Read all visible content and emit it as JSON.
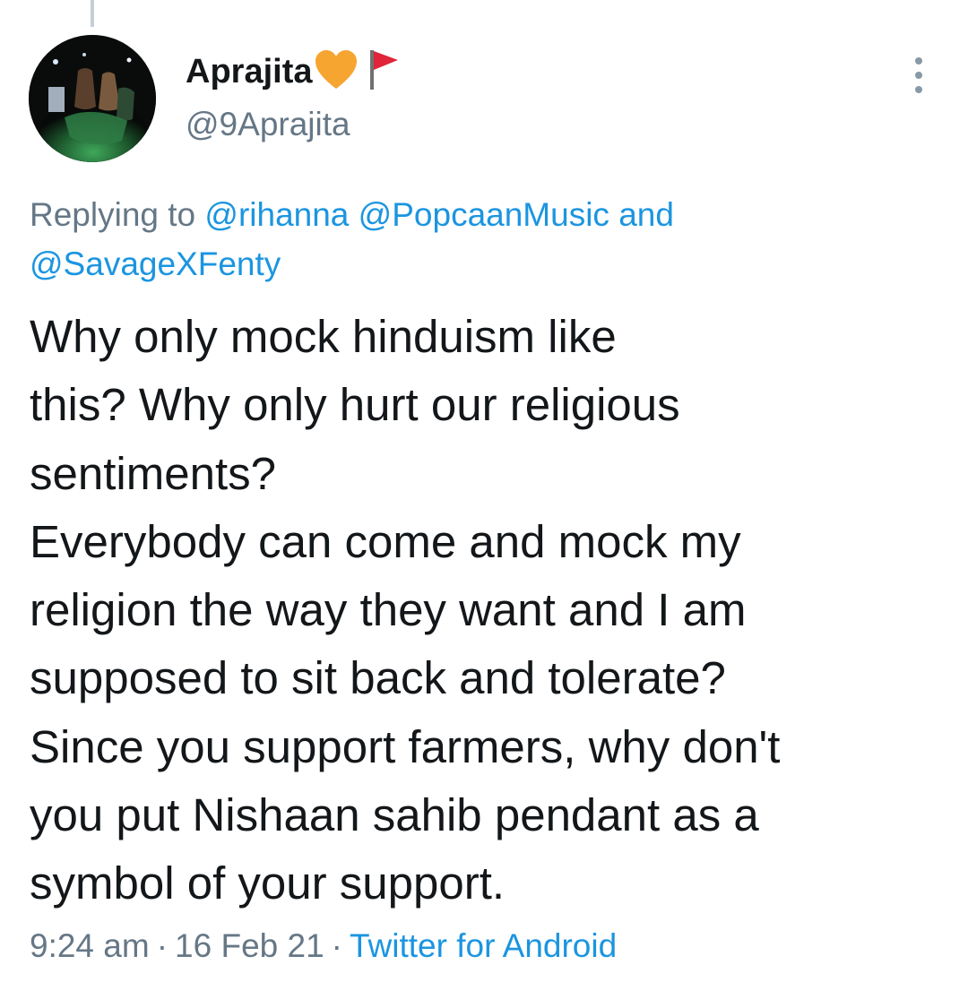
{
  "tweet": {
    "author": {
      "display_name": "Aprajita",
      "handle": "@9Aprajita",
      "emoji": {
        "heart_color": "#f7a531",
        "flag_color": "#e0243a",
        "flag_pole_color": "#707070"
      }
    },
    "reply_context": {
      "prefix": "Replying to",
      "mentions": [
        "@rihanna",
        "@PopcaanMusic"
      ],
      "conjunction": "and",
      "last_mention": "@SavageXFenty"
    },
    "text_lines": [
      "Why only mock hinduism like",
      "this? Why only hurt our religious",
      "sentiments?",
      "Everybody can come and mock my",
      "religion the way they want and I am",
      "supposed to sit back and tolerate?",
      "Since you support farmers, why don't",
      "you put Nishaan sahib pendant as a",
      "symbol of your support."
    ],
    "meta": {
      "time": "9:24 am",
      "separator": "·",
      "date": "16 Feb 21",
      "source": "Twitter for Android"
    }
  },
  "colors": {
    "text": "#14171a",
    "secondary": "#657786",
    "link": "#1b95e0",
    "thread_line": "#c4cfd6"
  }
}
